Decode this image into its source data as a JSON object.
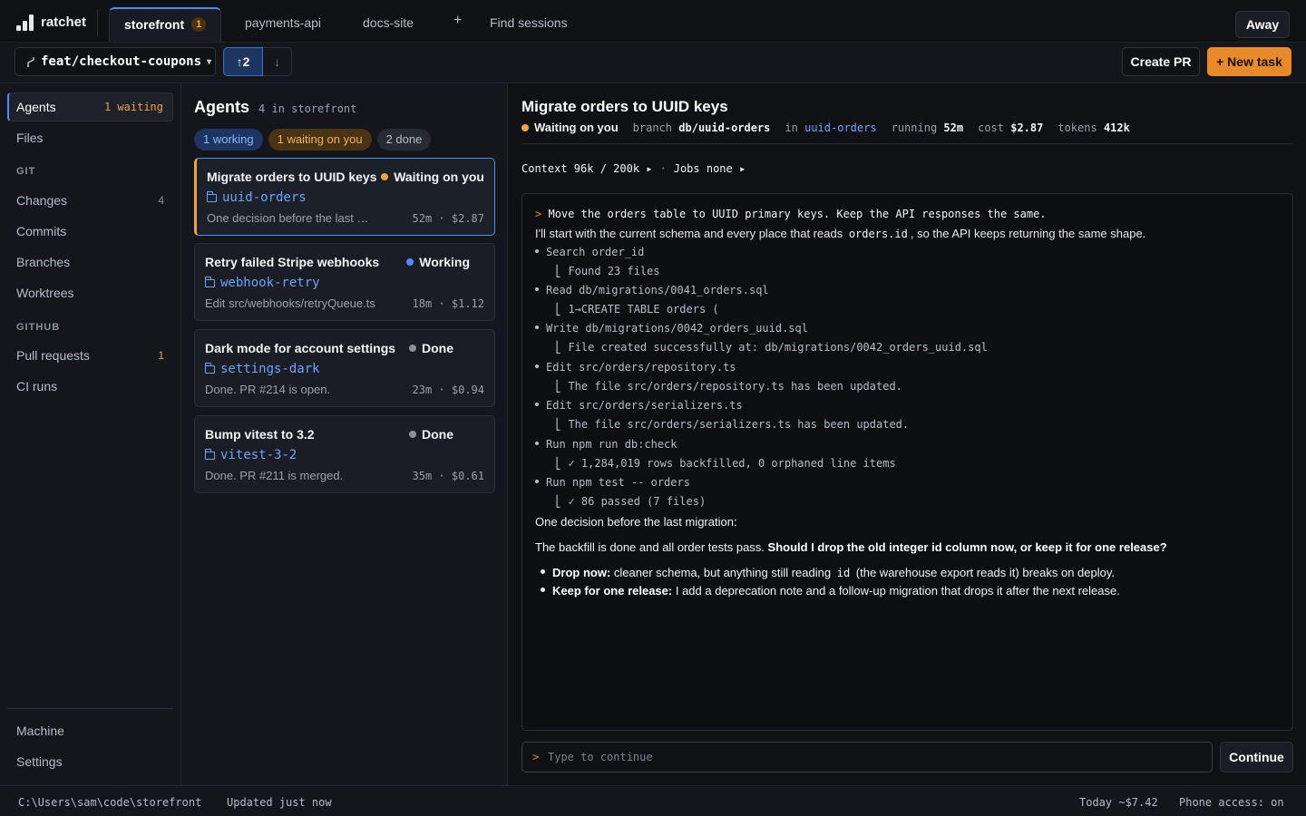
{
  "app": {
    "name": "ratchet"
  },
  "tabs": [
    {
      "label": "storefront",
      "badge": "1"
    },
    {
      "label": "payments-api"
    },
    {
      "label": "docs-site"
    }
  ],
  "tab_add_icon": "+",
  "find_sessions": "Find sessions",
  "away_label": "Away",
  "branch": {
    "name": "feat/checkout-coupons",
    "ahead": "↑2",
    "behind": "↓"
  },
  "actions": {
    "create_pr": "Create PR",
    "new_task": "+ New task"
  },
  "nav": {
    "agents": {
      "label": "Agents",
      "count": "1 waiting"
    },
    "files": "Files",
    "git_section": "GIT",
    "changes": {
      "label": "Changes",
      "count": "4"
    },
    "commits": "Commits",
    "branches": "Branches",
    "worktrees": "Worktrees",
    "github_section": "GITHUB",
    "pull_requests": {
      "label": "Pull requests",
      "count": "1"
    },
    "ci_runs": "CI runs",
    "machine": "Machine",
    "settings": "Settings"
  },
  "agents_panel": {
    "title": "Agents",
    "subtitle": "4 in storefront",
    "filters": [
      "1 working",
      "1 waiting on you",
      "2 done"
    ],
    "cards": [
      {
        "title": "Migrate orders to UUID keys",
        "status": "Waiting on you",
        "branch": "uuid-orders",
        "desc": "One decision before the last migration:",
        "time": "52m",
        "cost": "$2.87"
      },
      {
        "title": "Retry failed Stripe webhooks",
        "status": "Working",
        "branch": "webhook-retry",
        "desc": "Edit src/webhooks/retryQueue.ts",
        "time": "18m",
        "cost": "$1.12"
      },
      {
        "title": "Dark mode for account settings",
        "status": "Done",
        "branch": "settings-dark",
        "desc": "Done. PR #214 is open.",
        "time": "23m",
        "cost": "$0.94"
      },
      {
        "title": "Bump vitest to 3.2",
        "status": "Done",
        "branch": "vitest-3-2",
        "desc": "Done. PR #211 is merged.",
        "time": "35m",
        "cost": "$0.61"
      }
    ]
  },
  "detail": {
    "title": "Migrate orders to UUID keys",
    "status": "Waiting on you",
    "branch_label": "branch",
    "branch": "db/uuid-orders",
    "in_label": "in",
    "worktree": "uuid-orders",
    "running_label": "running",
    "running": "52m",
    "cost_label": "cost",
    "cost": "$2.87",
    "tokens_label": "tokens",
    "tokens": "412k",
    "context": "Context 96k / 200k ▸",
    "context_sep": "·",
    "jobs": "Jobs none ▸"
  },
  "transcript": {
    "prompt_marker": ">",
    "prompt": "Move the orders table to UUID primary keys. Keep the API responses the same.",
    "intro_pre": "I'll start with the current schema and every place that reads",
    "intro_code": "orders.id",
    "intro_post": ", so the API keeps returning the same shape.",
    "steps": [
      {
        "call": "Search order_id",
        "result": "⎣ Found 23 files"
      },
      {
        "call": "Read db/migrations/0041_orders.sql",
        "result": "⎣ 1→CREATE TABLE orders ("
      },
      {
        "call": "Write db/migrations/0042_orders_uuid.sql",
        "result": "⎣ File created successfully at: db/migrations/0042_orders_uuid.sql"
      },
      {
        "call": "Edit src/orders/repository.ts",
        "result": "⎣ The file src/orders/repository.ts has been updated."
      },
      {
        "call": "Edit src/orders/serializers.ts",
        "result": "⎣ The file src/orders/serializers.ts has been updated."
      },
      {
        "call": "Run npm run db:check",
        "result": "⎣ ✓ 1,284,019 rows backfilled, 0 orphaned line items"
      },
      {
        "call": "Run npm test -- orders",
        "result": "⎣ ✓ 86 passed (7 files)"
      }
    ],
    "decision_intro": "One decision before the last migration:",
    "question_pre": "The backfill is done and all order tests pass.",
    "question_bold": "Should I drop the old integer id column now, or keep it for one release?",
    "option1_bold": "Drop now:",
    "option1_pre": "cleaner schema, but anything still reading",
    "option1_code": "id",
    "option1_post": "(the warehouse export reads it) breaks on deploy.",
    "option2_bold": "Keep for one release:",
    "option2_text": "I add a deprecation note and a follow-up migration that drops it after the next release."
  },
  "composer": {
    "marker": ">",
    "placeholder": "Type to continue",
    "button": "Continue"
  },
  "status_bar": {
    "path": "C:\\Users\\sam\\code\\storefront",
    "updated": "Updated just now",
    "today": "Today ~$7.42",
    "phone": "Phone access: on"
  }
}
